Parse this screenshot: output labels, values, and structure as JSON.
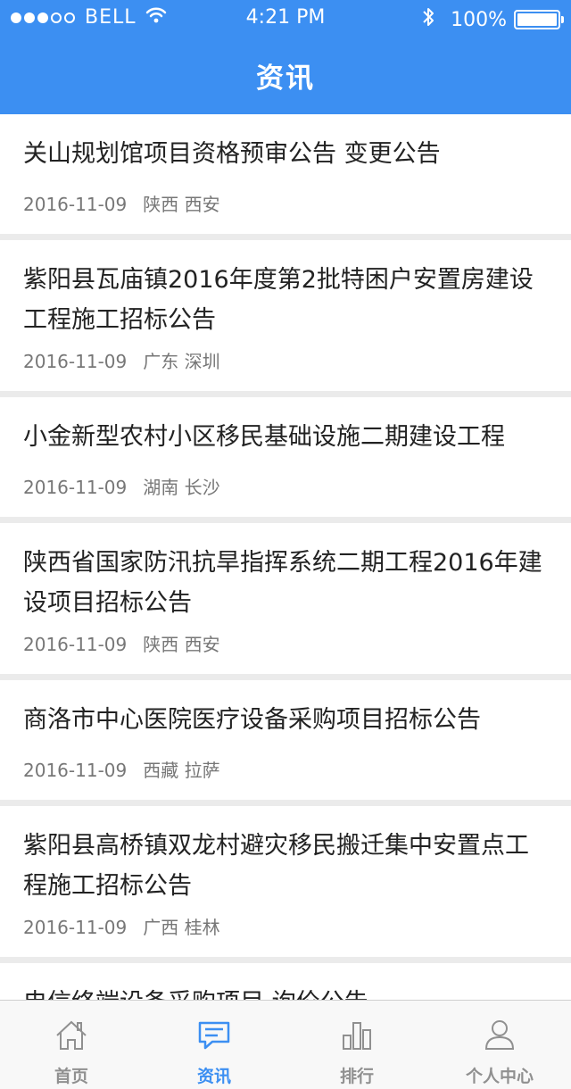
{
  "status_bar": {
    "carrier": "BELL",
    "time": "4:21 PM",
    "battery": "100%",
    "battery_level": 1.0,
    "signal_dots_filled": 3,
    "signal_dots_total": 5
  },
  "header": {
    "title": "资讯"
  },
  "news": [
    {
      "title": "关山规划馆项目资格预审公告 变更公告",
      "date": "2016-11-09",
      "location": "陕西 西安"
    },
    {
      "title": "紫阳县瓦庙镇2016年度第2批特困户安置房建设工程施工招标公告",
      "date": "2016-11-09",
      "location": "广东 深圳"
    },
    {
      "title": "小金新型农村小区移民基础设施二期建设工程",
      "date": "2016-11-09",
      "location": "湖南 长沙"
    },
    {
      "title": "陕西省国家防汛抗旱指挥系统二期工程2016年建设项目招标公告",
      "date": "2016-11-09",
      "location": "陕西 西安"
    },
    {
      "title": "商洛市中心医院医疗设备采购项目招标公告",
      "date": "2016-11-09",
      "location": "西藏 拉萨"
    },
    {
      "title": "紫阳县高桥镇双龙村避灾移民搬迁集中安置点工程施工招标公告",
      "date": "2016-11-09",
      "location": "广西 桂林"
    },
    {
      "title": "电信终端设备采购项目 询价公告",
      "date": "",
      "location": ""
    }
  ],
  "tabbar": {
    "tabs": [
      {
        "label": "首页",
        "icon": "home-icon",
        "active": false
      },
      {
        "label": "资讯",
        "icon": "message-icon",
        "active": true
      },
      {
        "label": "排行",
        "icon": "bar-chart-icon",
        "active": false
      },
      {
        "label": "个人中心",
        "icon": "user-icon",
        "active": false
      }
    ]
  },
  "colors": {
    "accent": "#3c8ff2",
    "inactive": "#909090",
    "background": "#ebebeb"
  }
}
